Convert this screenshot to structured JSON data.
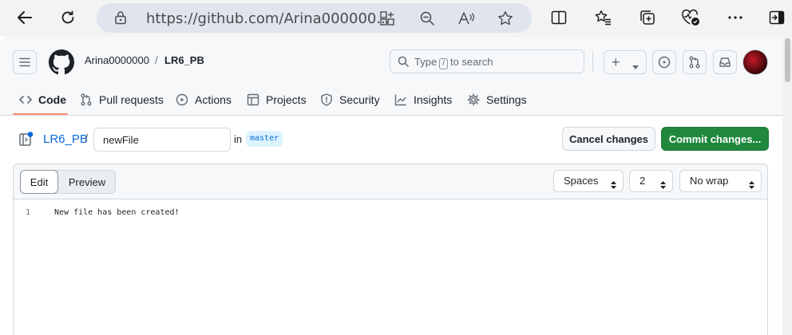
{
  "browser": {
    "url": "https://github.com/Arina000000...",
    "icons": [
      "back-icon",
      "refresh-icon",
      "lock-icon",
      "app-grid-icon",
      "zoom-out-icon",
      "read-aloud-icon",
      "favorite-star-icon",
      "split-screen-icon",
      "favorites-list-icon",
      "collections-icon",
      "browser-essentials-icon",
      "more-icon",
      "sidebar-icon"
    ]
  },
  "header": {
    "owner": "Arina0000000",
    "separator": "/",
    "repo": "LR6_PB",
    "search": {
      "prefix": "Type",
      "key": "/",
      "suffix": "to search"
    },
    "create_label": "+",
    "accent_color": "#fd8c73"
  },
  "tabs": [
    {
      "label": "Code",
      "icon": "code-icon",
      "active": true
    },
    {
      "label": "Pull requests",
      "icon": "pull-request-icon"
    },
    {
      "label": "Actions",
      "icon": "play-icon"
    },
    {
      "label": "Projects",
      "icon": "table-icon"
    },
    {
      "label": "Security",
      "icon": "shield-icon"
    },
    {
      "label": "Insights",
      "icon": "graph-icon"
    },
    {
      "label": "Settings",
      "icon": "gear-icon"
    }
  ],
  "editor_bar": {
    "repo_link": "LR6_PB",
    "slash": "/",
    "filename": "newFile",
    "in_label": "in",
    "branch": "master",
    "cancel_label": "Cancel changes",
    "commit_label": "Commit changes...",
    "commit_color": "#1f883d"
  },
  "editor": {
    "edit_label": "Edit",
    "preview_label": "Preview",
    "indent_mode": "Spaces",
    "indent_size": "2",
    "wrap_mode": "No wrap",
    "lines": [
      {
        "number": "1",
        "text": "New file has been created!"
      }
    ]
  }
}
